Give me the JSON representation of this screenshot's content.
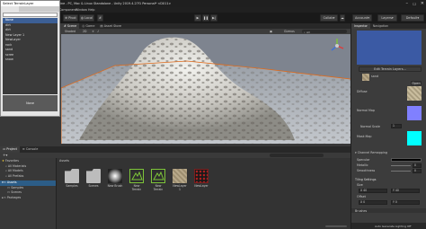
{
  "window": {
    "title": "Select TerrainLayer"
  },
  "select": {
    "items": [
      {
        "label": "None"
      },
      {
        "label": "dirt"
      },
      {
        "label": "dirt"
      },
      {
        "label": "New Layer 1"
      },
      {
        "label": "NewLayer"
      },
      {
        "label": "rock"
      },
      {
        "label": "sand"
      },
      {
        "label": "scree"
      },
      {
        "label": "snow"
      }
    ],
    "footer": "None"
  },
  "unity": {
    "title": "ine - PC, Mac & Linux Standalone - Unity 2019.4.27f1 Personal* <DX11>",
    "menu": [
      "Component",
      "Window",
      "Help"
    ],
    "toolbar": {
      "pivot": "Pivot",
      "local": "Local",
      "collab": "Collab",
      "account": "Account",
      "layers": "Layers",
      "layout": "Default"
    },
    "scene_tabs": [
      "Scene",
      "Game",
      "Asset Store"
    ],
    "scene_bar": {
      "shading": "Shaded",
      "mode": "2D",
      "gizmos": "Gizmos",
      "search": "All"
    },
    "project_tabs": [
      "Project",
      "Console"
    ],
    "tree": [
      {
        "label": "Favorites",
        "level": 0
      },
      {
        "label": "All Materials",
        "level": 1
      },
      {
        "label": "All Models",
        "level": 1
      },
      {
        "label": "All Prefabs",
        "level": 1
      },
      {
        "label": "Assets",
        "level": 0
      },
      {
        "label": "Samples",
        "level": 1
      },
      {
        "label": "Scenes",
        "level": 1
      },
      {
        "label": "Packages",
        "level": 0
      }
    ],
    "assets_header": "Assets",
    "assets": [
      {
        "label": "Samples",
        "kind": "folder"
      },
      {
        "label": "Scenes",
        "kind": "folder"
      },
      {
        "label": "New Brush",
        "kind": "brush"
      },
      {
        "label": "New Terrain",
        "kind": "terrain"
      },
      {
        "label": "New Terrain",
        "kind": "terrain"
      },
      {
        "label": "NewLayer 1",
        "kind": "layer"
      },
      {
        "label": "NewLayer",
        "kind": "layer-red"
      }
    ]
  },
  "inspector": {
    "tabs": [
      "Inspector",
      "Navigation"
    ],
    "edit_button": "Edit Terrain Layers...",
    "layer_name": "sand",
    "open_button": "Open",
    "diffuse_label": "Diffuse",
    "normal_map_label": "Normal Map",
    "normal_scale_label": "Normal Scale",
    "normal_scale_value": "1",
    "mask_map_label": "Mask Map",
    "channel_remapping": "Channel Remapping",
    "specular_label": "Specular",
    "metallic_label": "Metallic",
    "metallic_value": "0",
    "smoothness_label": "Smoothness",
    "smoothness_value": "0",
    "tiling_settings": "Tiling Settings",
    "size_label": "Size",
    "size_x": "X 40",
    "size_y": "Y 40",
    "offset_label": "Offset",
    "offset_x": "X 0",
    "offset_y": "Y 0",
    "brushes": "Brushes",
    "status": "Auto Generate Lighting Off"
  },
  "colors": {
    "accent": "#3c5f95",
    "normal_map": "#8080ff",
    "mask_map": "#00ffff",
    "terrain_icon": "#7ec639"
  }
}
